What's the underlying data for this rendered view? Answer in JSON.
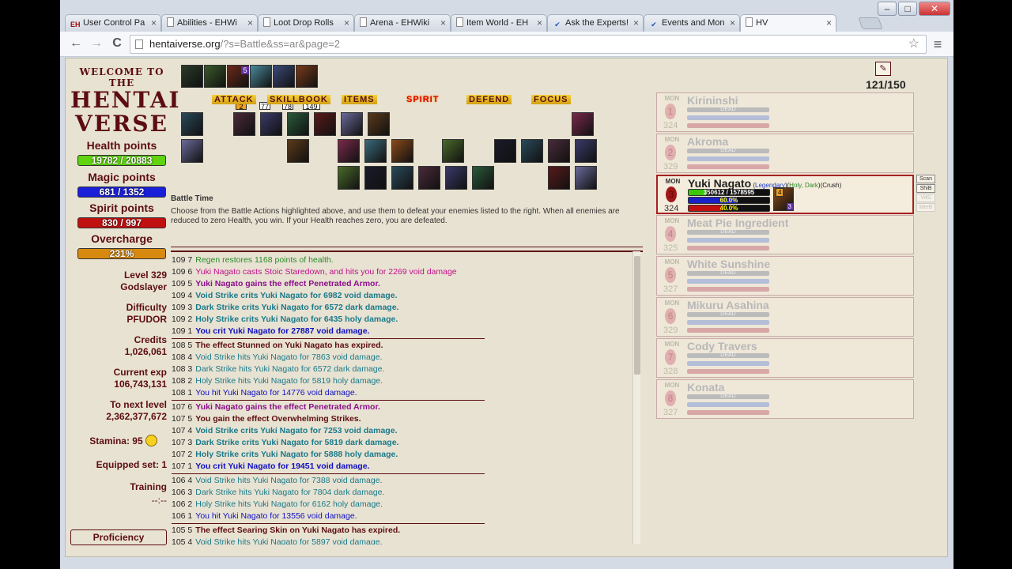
{
  "window": {
    "minimize_label": "–",
    "maximize_label": "□",
    "close_label": "✕"
  },
  "tabs": [
    {
      "label": "User Control Pa",
      "icon": "EH"
    },
    {
      "label": "Abilities - EHWi",
      "icon": "doc"
    },
    {
      "label": "Loot Drop Rolls",
      "icon": "doc"
    },
    {
      "label": "Arena - EHWiki",
      "icon": "doc"
    },
    {
      "label": "Item World - EH",
      "icon": "doc"
    },
    {
      "label": "Ask the Experts!",
      "icon": "check"
    },
    {
      "label": "Events and Mon",
      "icon": "check"
    },
    {
      "label": "HV",
      "icon": "doc",
      "active": true
    }
  ],
  "toolbar": {
    "back": "←",
    "forward": "→",
    "reload": "C",
    "url_host": "hentaiverse.org",
    "url_path": "/?s=Battle&ss=ar&page=2",
    "star": "☆",
    "menu": "≡"
  },
  "logo": {
    "line1": "WELCOME TO THE",
    "line2": "HENTAI",
    "line3": "VERSE"
  },
  "stats": {
    "health_label": "Health points",
    "health_value": "19782 / 20883",
    "magic_label": "Magic points",
    "magic_value": "681 / 1352",
    "spirit_label": "Spirit points",
    "spirit_value": "830 / 997",
    "overcharge_label": "Overcharge",
    "overcharge_value": "231%",
    "level": "Level 329",
    "title": "Godslayer",
    "difficulty_label": "Difficulty",
    "difficulty_value": "PFUDOR",
    "credits_label": "Credits",
    "credits_value": "1,026,061",
    "exp_label": "Current exp",
    "exp_value": "106,743,131",
    "next_label": "To next level",
    "next_value": "2,362,377,672",
    "stamina": "Stamina: 95",
    "equipped": "Equipped set: 1",
    "training_label": "Training",
    "training_value": "--:--",
    "proficiency": "Proficiency"
  },
  "quickbar_badges": [
    "2",
    "5",
    "77",
    "78",
    "149"
  ],
  "categories": [
    "ATTACK",
    "SKILLBOOK",
    "ITEMS",
    "SPIRIT",
    "DEFEND",
    "FOCUS"
  ],
  "battle": {
    "title": "Battle Time",
    "description": "Choose from the Battle Actions highlighted above, and use them to defeat your enemies listed to the right. When all enemies are reduced to zero Health, you win. If your Health reaches zero, you are defeated."
  },
  "log": [
    {
      "n": "109 7",
      "t": "Regen restores 1168 points of health.",
      "c": "#2a8a2a",
      "b": false
    },
    {
      "n": "109 6",
      "t": "Yuki Nagato casts Stoic Staredown, and hits you for 2269 void damage",
      "c": "#c0108a",
      "b": false
    },
    {
      "n": "109 5",
      "t": "Yuki Nagato gains the effect Penetrated Armor.",
      "c": "#8a108a",
      "b": true
    },
    {
      "n": "109 4",
      "t": "Void Strike crits Yuki Nagato for 6982 void damage.",
      "c": "#1a7a8a",
      "b": true
    },
    {
      "n": "109 3",
      "t": "Dark Strike crits Yuki Nagato for 6572 dark damage.",
      "c": "#1a7a8a",
      "b": true
    },
    {
      "n": "109 2",
      "t": "Holy Strike crits Yuki Nagato for 6435 holy damage.",
      "c": "#1a7a8a",
      "b": true
    },
    {
      "n": "109 1",
      "t": "You crit Yuki Nagato for 27887 void damage.",
      "c": "#1010c0",
      "b": true
    },
    {
      "n": "108 5",
      "t": "The effect Stunned on Yuki Nagato has expired.",
      "c": "#5c0d12",
      "b": true
    },
    {
      "n": "108 4",
      "t": "Void Strike hits Yuki Nagato for 7863 void damage.",
      "c": "#1a7a8a",
      "b": false
    },
    {
      "n": "108 3",
      "t": "Dark Strike hits Yuki Nagato for 6572 dark damage.",
      "c": "#1a7a8a",
      "b": false
    },
    {
      "n": "108 2",
      "t": "Holy Strike hits Yuki Nagato for 5819 holy damage.",
      "c": "#1a7a8a",
      "b": false
    },
    {
      "n": "108 1",
      "t": "You hit Yuki Nagato for 14776 void damage.",
      "c": "#1010c0",
      "b": false
    },
    {
      "n": "107 6",
      "t": "Yuki Nagato gains the effect Penetrated Armor.",
      "c": "#8a108a",
      "b": true
    },
    {
      "n": "107 5",
      "t": "You gain the effect Overwhelming Strikes.",
      "c": "#5c0d12",
      "b": true
    },
    {
      "n": "107 4",
      "t": "Void Strike crits Yuki Nagato for 7253 void damage.",
      "c": "#1a7a8a",
      "b": true
    },
    {
      "n": "107 3",
      "t": "Dark Strike crits Yuki Nagato for 5819 dark damage.",
      "c": "#1a7a8a",
      "b": true
    },
    {
      "n": "107 2",
      "t": "Holy Strike crits Yuki Nagato for 5888 holy damage.",
      "c": "#1a7a8a",
      "b": true
    },
    {
      "n": "107 1",
      "t": "You crit Yuki Nagato for 19451 void damage.",
      "c": "#1010c0",
      "b": true
    },
    {
      "n": "106 4",
      "t": "Void Strike hits Yuki Nagato for 7388 void damage.",
      "c": "#1a7a8a",
      "b": false
    },
    {
      "n": "106 3",
      "t": "Dark Strike hits Yuki Nagato for 7804 dark damage.",
      "c": "#1a7a8a",
      "b": false
    },
    {
      "n": "106 2",
      "t": "Holy Strike hits Yuki Nagato for 6162 holy damage.",
      "c": "#1a7a8a",
      "b": false
    },
    {
      "n": "106 1",
      "t": "You hit Yuki Nagato for 13556 void damage.",
      "c": "#1010c0",
      "b": false
    },
    {
      "n": "105 5",
      "t": "The effect Searing Skin on Yuki Nagato has expired.",
      "c": "#5c0d12",
      "b": true
    },
    {
      "n": "105 4",
      "t": "Void Strike hits Yuki Nagato for 5897 void damage.",
      "c": "#1a7a8a",
      "b": false
    }
  ],
  "counter": "121/150",
  "monsters": [
    {
      "label": "MON",
      "num": "1",
      "name": "Kirininshi",
      "level": "324",
      "dead": "DEAD"
    },
    {
      "label": "MON",
      "num": "2",
      "name": "Akroma",
      "level": "329",
      "dead": "DEAD"
    },
    {
      "label": "MON",
      "num": "3",
      "name": "Yuki Nagato",
      "level": "324",
      "active": true,
      "tag_legendary": "Legendary",
      "tag_elem": "Holy, Dark",
      "tag_crush": "Crush",
      "hp": "350612 / 1578595",
      "mp_pct": "60.0%",
      "sp_pct": "40.0%",
      "badge_top": "4",
      "badge_bottom": "3"
    },
    {
      "label": "MON",
      "num": "4",
      "name": "Meat Pie Ingredient",
      "level": "325",
      "dead": "DEAD"
    },
    {
      "label": "MON",
      "num": "5",
      "name": "White Sunshine",
      "level": "327",
      "dead": "DEAD"
    },
    {
      "label": "MON",
      "num": "6",
      "name": "Mikuru Asahina",
      "level": "329",
      "dead": "DEAD"
    },
    {
      "label": "MON",
      "num": "7",
      "name": "Cody Travers",
      "level": "328",
      "dead": "DEAD"
    },
    {
      "label": "MON",
      "num": "8",
      "name": "Konata",
      "level": "327",
      "dead": "DEAD"
    }
  ],
  "monster_buttons": [
    "Scan",
    "ShiB",
    "VitS",
    "MerB"
  ]
}
